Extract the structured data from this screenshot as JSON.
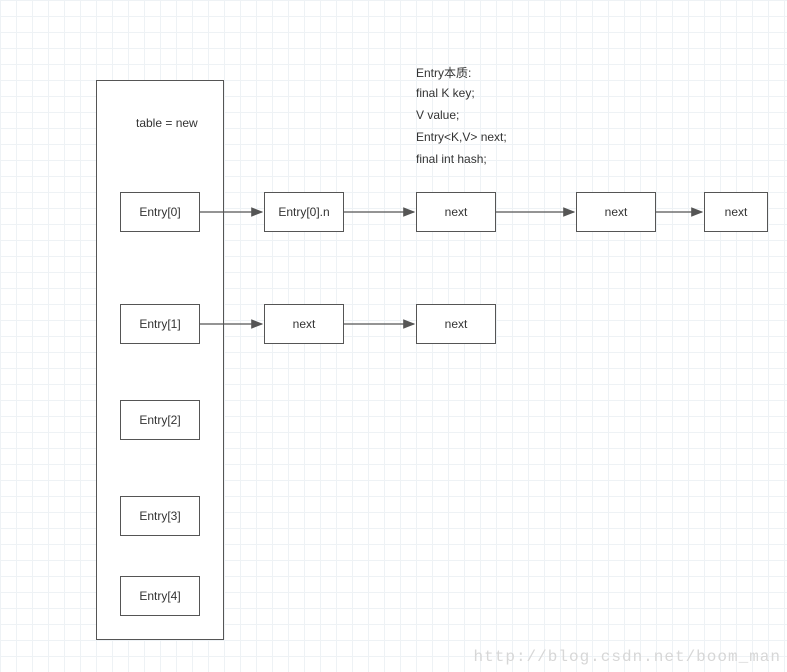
{
  "table_label": "table = new",
  "entries": [
    "Entry[0]",
    "Entry[1]",
    "Entry[2]",
    "Entry[3]",
    "Entry[4]"
  ],
  "chain0": [
    "Entry[0].n",
    "next",
    "next",
    "next"
  ],
  "chain1": [
    "next",
    "next"
  ],
  "desc_lines": [
    "Entry本质:",
    "final K key;",
    "V value;",
    "Entry<K,V> next;",
    "final int hash;"
  ],
  "watermark": "http://blog.csdn.net/boom_man"
}
